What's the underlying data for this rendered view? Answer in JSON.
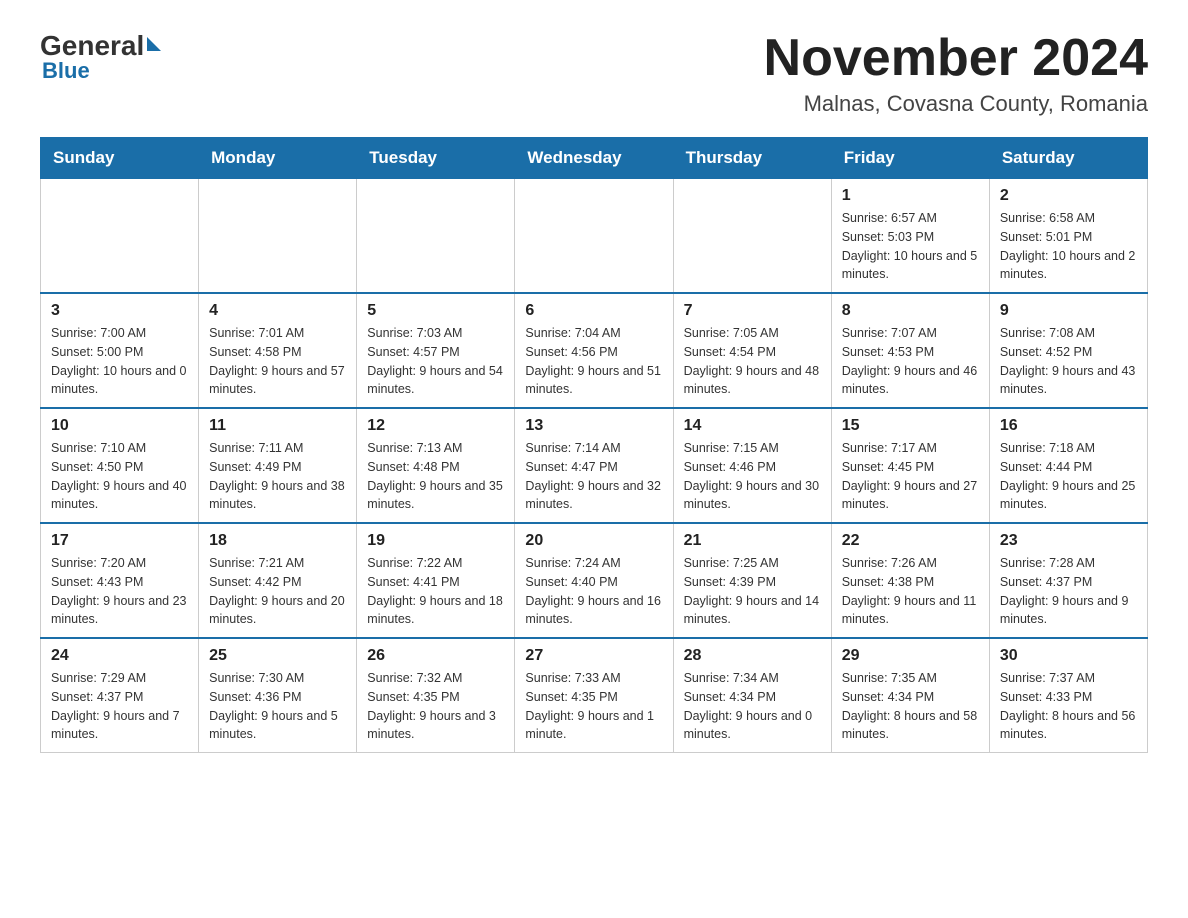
{
  "header": {
    "logo_general": "General",
    "logo_blue": "Blue",
    "month_title": "November 2024",
    "location": "Malnas, Covasna County, Romania"
  },
  "weekdays": [
    "Sunday",
    "Monday",
    "Tuesday",
    "Wednesday",
    "Thursday",
    "Friday",
    "Saturday"
  ],
  "weeks": [
    [
      {
        "day": "",
        "info": ""
      },
      {
        "day": "",
        "info": ""
      },
      {
        "day": "",
        "info": ""
      },
      {
        "day": "",
        "info": ""
      },
      {
        "day": "",
        "info": ""
      },
      {
        "day": "1",
        "info": "Sunrise: 6:57 AM\nSunset: 5:03 PM\nDaylight: 10 hours and 5 minutes."
      },
      {
        "day": "2",
        "info": "Sunrise: 6:58 AM\nSunset: 5:01 PM\nDaylight: 10 hours and 2 minutes."
      }
    ],
    [
      {
        "day": "3",
        "info": "Sunrise: 7:00 AM\nSunset: 5:00 PM\nDaylight: 10 hours and 0 minutes."
      },
      {
        "day": "4",
        "info": "Sunrise: 7:01 AM\nSunset: 4:58 PM\nDaylight: 9 hours and 57 minutes."
      },
      {
        "day": "5",
        "info": "Sunrise: 7:03 AM\nSunset: 4:57 PM\nDaylight: 9 hours and 54 minutes."
      },
      {
        "day": "6",
        "info": "Sunrise: 7:04 AM\nSunset: 4:56 PM\nDaylight: 9 hours and 51 minutes."
      },
      {
        "day": "7",
        "info": "Sunrise: 7:05 AM\nSunset: 4:54 PM\nDaylight: 9 hours and 48 minutes."
      },
      {
        "day": "8",
        "info": "Sunrise: 7:07 AM\nSunset: 4:53 PM\nDaylight: 9 hours and 46 minutes."
      },
      {
        "day": "9",
        "info": "Sunrise: 7:08 AM\nSunset: 4:52 PM\nDaylight: 9 hours and 43 minutes."
      }
    ],
    [
      {
        "day": "10",
        "info": "Sunrise: 7:10 AM\nSunset: 4:50 PM\nDaylight: 9 hours and 40 minutes."
      },
      {
        "day": "11",
        "info": "Sunrise: 7:11 AM\nSunset: 4:49 PM\nDaylight: 9 hours and 38 minutes."
      },
      {
        "day": "12",
        "info": "Sunrise: 7:13 AM\nSunset: 4:48 PM\nDaylight: 9 hours and 35 minutes."
      },
      {
        "day": "13",
        "info": "Sunrise: 7:14 AM\nSunset: 4:47 PM\nDaylight: 9 hours and 32 minutes."
      },
      {
        "day": "14",
        "info": "Sunrise: 7:15 AM\nSunset: 4:46 PM\nDaylight: 9 hours and 30 minutes."
      },
      {
        "day": "15",
        "info": "Sunrise: 7:17 AM\nSunset: 4:45 PM\nDaylight: 9 hours and 27 minutes."
      },
      {
        "day": "16",
        "info": "Sunrise: 7:18 AM\nSunset: 4:44 PM\nDaylight: 9 hours and 25 minutes."
      }
    ],
    [
      {
        "day": "17",
        "info": "Sunrise: 7:20 AM\nSunset: 4:43 PM\nDaylight: 9 hours and 23 minutes."
      },
      {
        "day": "18",
        "info": "Sunrise: 7:21 AM\nSunset: 4:42 PM\nDaylight: 9 hours and 20 minutes."
      },
      {
        "day": "19",
        "info": "Sunrise: 7:22 AM\nSunset: 4:41 PM\nDaylight: 9 hours and 18 minutes."
      },
      {
        "day": "20",
        "info": "Sunrise: 7:24 AM\nSunset: 4:40 PM\nDaylight: 9 hours and 16 minutes."
      },
      {
        "day": "21",
        "info": "Sunrise: 7:25 AM\nSunset: 4:39 PM\nDaylight: 9 hours and 14 minutes."
      },
      {
        "day": "22",
        "info": "Sunrise: 7:26 AM\nSunset: 4:38 PM\nDaylight: 9 hours and 11 minutes."
      },
      {
        "day": "23",
        "info": "Sunrise: 7:28 AM\nSunset: 4:37 PM\nDaylight: 9 hours and 9 minutes."
      }
    ],
    [
      {
        "day": "24",
        "info": "Sunrise: 7:29 AM\nSunset: 4:37 PM\nDaylight: 9 hours and 7 minutes."
      },
      {
        "day": "25",
        "info": "Sunrise: 7:30 AM\nSunset: 4:36 PM\nDaylight: 9 hours and 5 minutes."
      },
      {
        "day": "26",
        "info": "Sunrise: 7:32 AM\nSunset: 4:35 PM\nDaylight: 9 hours and 3 minutes."
      },
      {
        "day": "27",
        "info": "Sunrise: 7:33 AM\nSunset: 4:35 PM\nDaylight: 9 hours and 1 minute."
      },
      {
        "day": "28",
        "info": "Sunrise: 7:34 AM\nSunset: 4:34 PM\nDaylight: 9 hours and 0 minutes."
      },
      {
        "day": "29",
        "info": "Sunrise: 7:35 AM\nSunset: 4:34 PM\nDaylight: 8 hours and 58 minutes."
      },
      {
        "day": "30",
        "info": "Sunrise: 7:37 AM\nSunset: 4:33 PM\nDaylight: 8 hours and 56 minutes."
      }
    ]
  ]
}
